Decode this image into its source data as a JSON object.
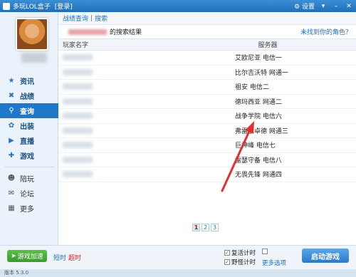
{
  "window": {
    "title": "多玩LOL盒子",
    "login": "[登录]",
    "settings": "设置"
  },
  "sidebar": {
    "items": [
      {
        "label": "资讯",
        "icon": "star-icon"
      },
      {
        "label": "战绩",
        "icon": "x-icon"
      },
      {
        "label": "查询",
        "icon": "search-icon"
      },
      {
        "label": "出装",
        "icon": "gear-icon"
      },
      {
        "label": "直播",
        "icon": "play-icon"
      },
      {
        "label": "游戏",
        "icon": "gamepad-icon"
      }
    ],
    "secondary": [
      {
        "label": "陪玩",
        "icon": "people-icon"
      },
      {
        "label": "论坛",
        "icon": "chat-icon"
      },
      {
        "label": "更多",
        "icon": "grid-icon"
      }
    ]
  },
  "breadcrumb": {
    "parent": "战绩查询",
    "separator": "|",
    "current": "搜索"
  },
  "results": {
    "suffix": "的搜索结果",
    "missing_link": "未找到你的角色？"
  },
  "table": {
    "columns": [
      "玩家名字",
      "服务器"
    ],
    "rows": [
      {
        "server": "艾欧尼亚 电信一"
      },
      {
        "server": "比尔吉沃特 网通一"
      },
      {
        "server": "祖安 电信二"
      },
      {
        "server": "德玛西亚 网通二"
      },
      {
        "server": "战争学院 电信六"
      },
      {
        "server": "弗雷尔卓德 网通三"
      },
      {
        "server": "巨神峰 电信七"
      },
      {
        "server": "雷瑟守备 电信八"
      },
      {
        "server": "无畏先锋 网通四"
      }
    ]
  },
  "pager": {
    "pages": [
      "1",
      "2",
      "3"
    ],
    "current": "1"
  },
  "bottom": {
    "game_accel": "游戏加速",
    "timer1": "短时",
    "timer2": "超时",
    "revive_timer": "复活计时",
    "jungle_timer": "野怪计时",
    "more_options": "更多选项",
    "start_game": "启动游戏"
  },
  "status": {
    "version": "版本 5.3.0"
  },
  "colors": {
    "accent": "#1f78c8",
    "annotation": "#e03030"
  }
}
